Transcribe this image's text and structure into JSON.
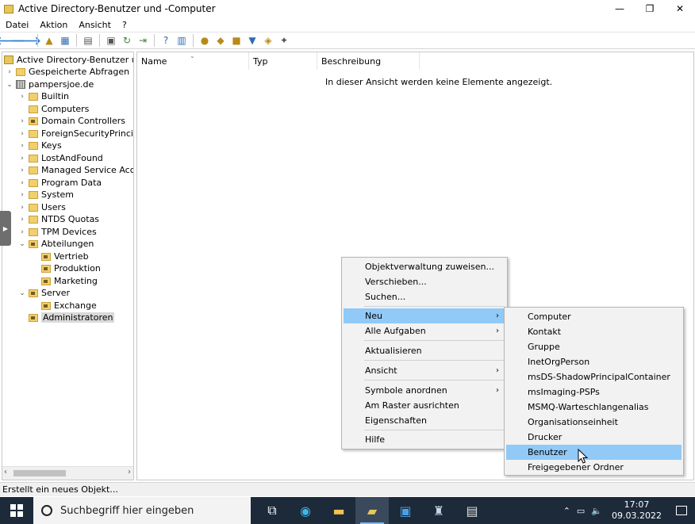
{
  "window": {
    "title": "Active Directory-Benutzer und -Computer",
    "minimize": "—",
    "maximize": "❐",
    "close": "✕"
  },
  "menubar": [
    "Datei",
    "Aktion",
    "Ansicht",
    "?"
  ],
  "tree": {
    "root": "Active Directory-Benutzer und -Computer",
    "items": [
      {
        "label": "Gespeicherte Abfragen",
        "level": 1
      },
      {
        "label": "pampersjoe.de",
        "level": 1
      },
      {
        "label": "Builtin",
        "level": 2
      },
      {
        "label": "Computers",
        "level": 2
      },
      {
        "label": "Domain Controllers",
        "level": 2
      },
      {
        "label": "ForeignSecurityPrincipals",
        "level": 2
      },
      {
        "label": "Keys",
        "level": 2
      },
      {
        "label": "LostAndFound",
        "level": 2
      },
      {
        "label": "Managed Service Accounts",
        "level": 2
      },
      {
        "label": "Program Data",
        "level": 2
      },
      {
        "label": "System",
        "level": 2
      },
      {
        "label": "Users",
        "level": 2
      },
      {
        "label": "NTDS Quotas",
        "level": 2
      },
      {
        "label": "TPM Devices",
        "level": 2
      },
      {
        "label": "Abteilungen",
        "level": 2
      },
      {
        "label": "Vertrieb",
        "level": 3
      },
      {
        "label": "Produktion",
        "level": 3
      },
      {
        "label": "Marketing",
        "level": 3
      },
      {
        "label": "Server",
        "level": 2
      },
      {
        "label": "Exchange",
        "level": 3
      },
      {
        "label": "Administratoren",
        "level": 2
      }
    ]
  },
  "list": {
    "columns": [
      "Name",
      "Typ",
      "Beschreibung"
    ],
    "empty_message": "In dieser Ansicht werden keine Elemente angezeigt."
  },
  "status": "Erstellt ein neues Objekt...",
  "context_menu": {
    "items": [
      "Objektverwaltung zuweisen...",
      "Verschieben...",
      "Suchen...",
      "Neu",
      "Alle Aufgaben",
      "Aktualisieren",
      "Ansicht",
      "Symbole anordnen",
      "Am Raster ausrichten",
      "Eigenschaften",
      "Hilfe"
    ],
    "highlighted": "Neu"
  },
  "submenu_new": {
    "items": [
      "Computer",
      "Kontakt",
      "Gruppe",
      "InetOrgPerson",
      "msDS-ShadowPrincipalContainer",
      "msImaging-PSPs",
      "MSMQ-Warteschlangenalias",
      "Organisationseinheit",
      "Drucker",
      "Benutzer",
      "Freigegebener Ordner"
    ],
    "highlighted": "Benutzer"
  },
  "taskbar": {
    "search_placeholder": "Suchbegriff hier eingeben",
    "time": "17:07",
    "date": "09.03.2022"
  },
  "colors": {
    "highlight": "#91c9f7",
    "taskbar": "#1c2a3a"
  }
}
